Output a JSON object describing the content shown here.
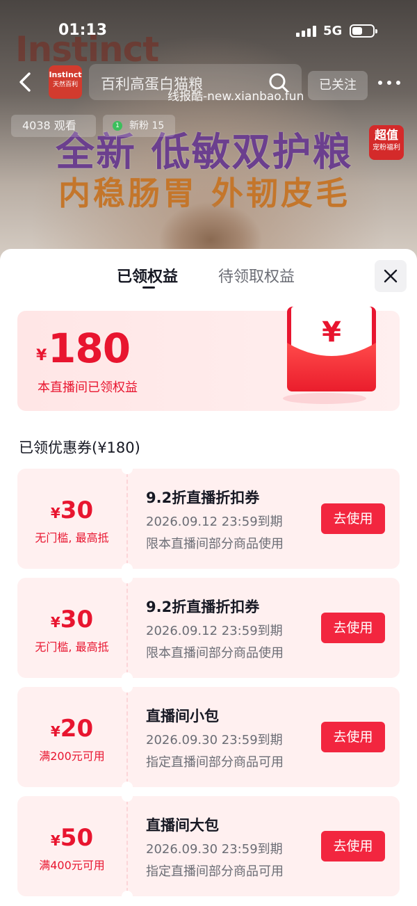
{
  "status_bar": {
    "time": "01:13",
    "network": "5G"
  },
  "live_room": {
    "brand_ghost": "Instinct",
    "shop_logo_line1": "Instinct",
    "shop_logo_line2": "天然百利",
    "search_text": "百利高蛋白猫粮",
    "follow_label": "已关注",
    "watermark": "线报酷-new.xianbao.fun",
    "viewers": "4038 观看",
    "new_fans": "新粉 15",
    "new_fans_rank": "1",
    "headline_1": "全新 低敏双护粮",
    "headline_2": "内稳肠胃 外韧皮毛",
    "badge_line1": "超值",
    "badge_line2": "宠粉福利"
  },
  "sheet": {
    "tabs": [
      {
        "label": "已领权益",
        "active": true
      },
      {
        "label": "待领取权益",
        "active": false
      }
    ],
    "summary": {
      "currency": "¥",
      "amount": "180",
      "caption": "本直播间已领权益",
      "packet_symbol": "¥"
    },
    "section_title": "已领优惠券(¥180)",
    "coupons": [
      {
        "currency": "¥",
        "amount": "30",
        "condition": "无门槛, 最高抵",
        "title": "9.2折直播折扣券",
        "expiry": "2026.09.12 23:59到期",
        "scope": "限本直播间部分商品使用",
        "button": "去使用"
      },
      {
        "currency": "¥",
        "amount": "30",
        "condition": "无门槛, 最高抵",
        "title": "9.2折直播折扣券",
        "expiry": "2026.09.12 23:59到期",
        "scope": "限本直播间部分商品使用",
        "button": "去使用"
      },
      {
        "currency": "¥",
        "amount": "20",
        "condition": "满200元可用",
        "title": "直播间小包",
        "expiry": "2026.09.30 23:59到期",
        "scope": "指定直播间部分商品可用",
        "button": "去使用"
      },
      {
        "currency": "¥",
        "amount": "50",
        "condition": "满400元可用",
        "title": "直播间大包",
        "expiry": "2026.09.30 23:59到期",
        "scope": "指定直播间部分商品可用",
        "button": "去使用"
      }
    ]
  },
  "colors": {
    "accent_red": "#e8152f",
    "button_red": "#f2263f",
    "coupon_bg": "#fff0f0"
  }
}
